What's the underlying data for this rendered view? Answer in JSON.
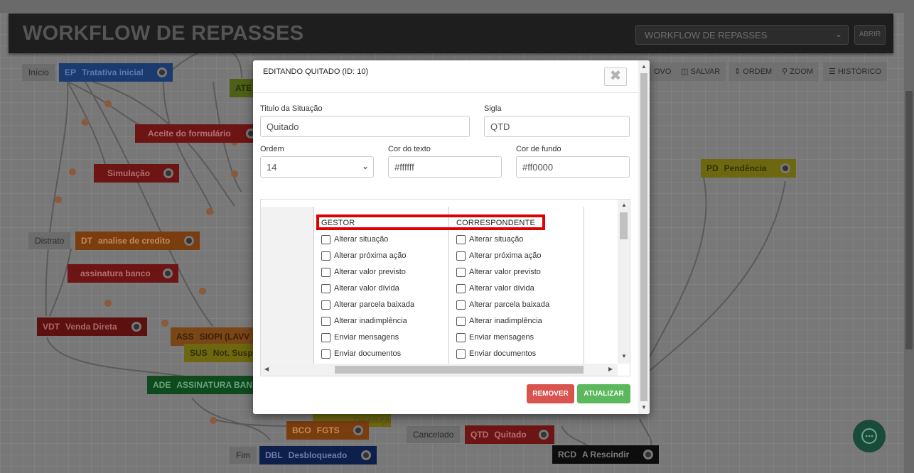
{
  "header": {
    "title": "WORKFLOW DE REPASSES",
    "select_value": "WORKFLOW DE REPASSES",
    "open_label": "ABRIR"
  },
  "toolbar": {
    "new_label": "OVO",
    "save_label": "SALVAR",
    "order_label": "ORDEM",
    "zoom_label": "ZOOM",
    "history_label": "HISTÓRICO"
  },
  "nodes": {
    "start": "Início",
    "ep": {
      "code": "EP",
      "name": "Tratativa inicial"
    },
    "ate": "ATE",
    "aceite": "Aceite do formulário",
    "simulacao": "Simulação",
    "pd": {
      "code": "PD",
      "name": "Pendência"
    },
    "distrato": "Distrato",
    "dt": {
      "code": "DT",
      "name": "analise de credito"
    },
    "assinatura_banco": "assinatura banco",
    "vdt": {
      "code": "VDT",
      "name": "Venda Direta"
    },
    "ass": {
      "code": "ASS",
      "name": "SIOPI (LAVV"
    },
    "sus": {
      "code": "SUS",
      "name": "Not. Susp"
    },
    "ade": {
      "code": "ADE",
      "name": "ASSINATURA BAN"
    },
    "bco": {
      "code": "BCO",
      "name": "FGTS"
    },
    "cancelado": "Cancelado",
    "qtd": {
      "code": "QTD",
      "name": "Quitado"
    },
    "fim": "Fim",
    "dbl": {
      "code": "DBL",
      "name": "Desbloqueado"
    },
    "rcd": {
      "code": "RCD",
      "name": "A Rescindir"
    },
    "hidden_label": "Devolução"
  },
  "modal": {
    "title": "EDITANDO QUITADO (ID: 10)",
    "close_symbol": "✖",
    "titulo_label": "Titulo da Situação",
    "titulo_value": "Quitado",
    "sigla_label": "Sigla",
    "sigla_value": "QTD",
    "ordem_label": "Ordem",
    "ordem_value": "14",
    "cor_texto_label": "Cor do texto",
    "cor_texto_value": "#ffffff",
    "cor_fundo_label": "Cor de fundo",
    "cor_fundo_value": "#ff0000",
    "columns": [
      "GESTOR",
      "CORRESPONDENTE"
    ],
    "permissions": [
      "Alterar situação",
      "Alterar próxima ação",
      "Alterar valor previsto",
      "Alterar valor dívida",
      "Alterar parcela baixada",
      "Alterar inadimplência",
      "Enviar mensagens",
      "Enviar documentos"
    ],
    "remove_label": "REMOVER",
    "update_label": "ATUALIZAR"
  },
  "colors": {
    "overlay": "#777777",
    "remove": "#d9534f",
    "update": "#5cb85c",
    "highlight": "#e00000"
  }
}
